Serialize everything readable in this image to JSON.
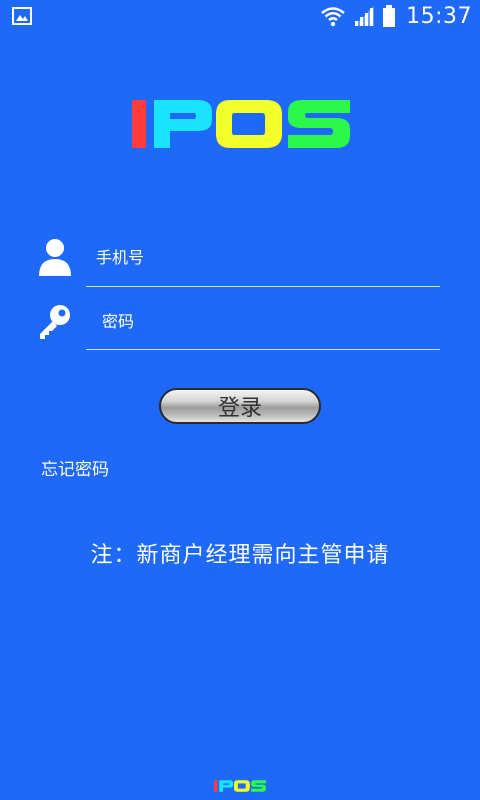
{
  "status_bar": {
    "time": "15:37",
    "left_icon": "image-notification-icon",
    "icons": [
      "wifi-icon",
      "signal-icon",
      "battery-icon"
    ]
  },
  "logo": {
    "text": "IPOS",
    "colors": [
      "#ff3b3b",
      "#19e4ff",
      "#f5ff2a",
      "#2bf94a"
    ]
  },
  "form": {
    "phone": {
      "icon": "user-icon",
      "placeholder": "手机号",
      "value": ""
    },
    "password": {
      "icon": "key-icon",
      "placeholder": "密码",
      "value": ""
    },
    "login_label": "登录",
    "forgot_label": "忘记密码"
  },
  "notice": "注：新商户经理需向主管申请",
  "footer": {
    "logo_text": "IPOS"
  },
  "colors": {
    "background": "#1f69f9",
    "text": "#ffffff",
    "underline": "#cfe0ff"
  }
}
